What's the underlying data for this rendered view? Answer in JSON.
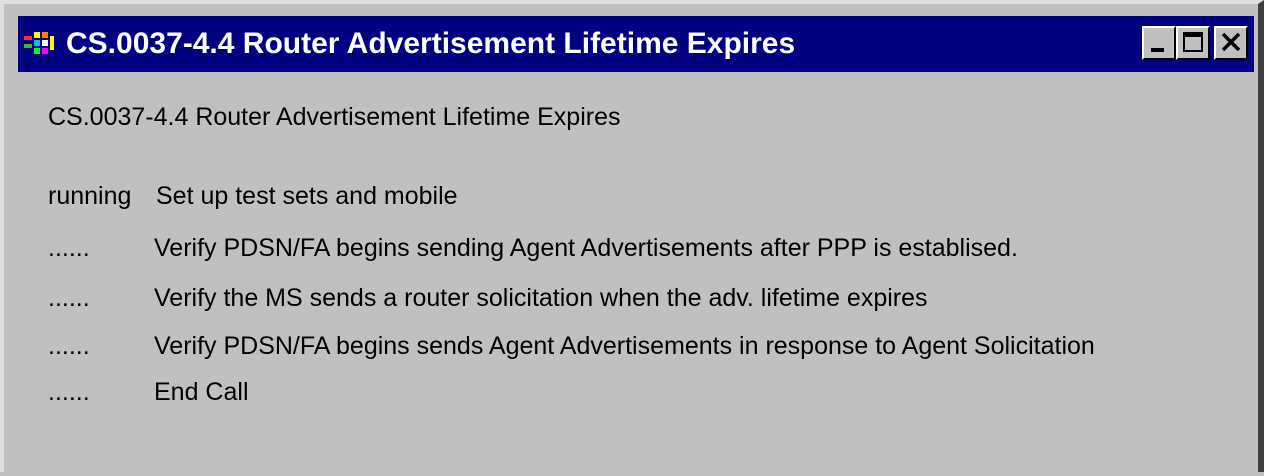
{
  "window": {
    "title": "CS.0037-4.4 Router Advertisement Lifetime Expires",
    "title_bar_color": "#000080",
    "background_color": "#c0c0c0",
    "icon": "app-icon",
    "controls": {
      "minimize_icon": "minimize-icon",
      "maximize_icon": "maximize-icon",
      "close_icon": "close-icon"
    }
  },
  "content": {
    "heading": "CS.0037-4.4 Router Advertisement Lifetime Expires",
    "steps": [
      {
        "status": "running",
        "description": "Set up test sets and mobile"
      },
      {
        "status": "......",
        "description": "Verify PDSN/FA begins sending Agent Advertisements after PPP is establised."
      },
      {
        "status": "......",
        "description": "Verify the MS sends a router solicitation when the adv. lifetime expires"
      },
      {
        "status": "......",
        "description": "Verify PDSN/FA begins sends Agent Advertisements in response to Agent Solicitation"
      },
      {
        "status": "......",
        "description": "End Call"
      }
    ]
  }
}
